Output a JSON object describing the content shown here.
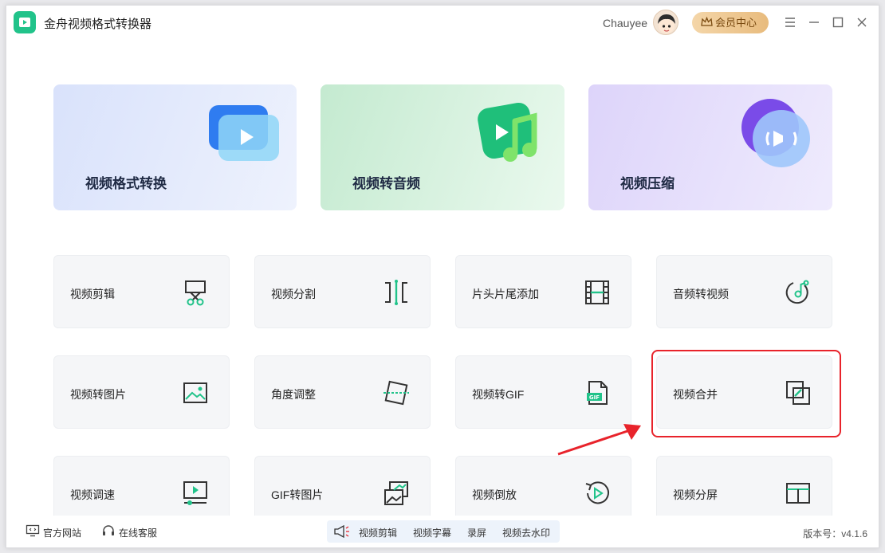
{
  "app": {
    "title": "金舟视频格式转换器"
  },
  "header": {
    "user_name": "Chauyee",
    "vip_label": "会员中心"
  },
  "feature_cards": [
    {
      "label": "视频格式转换",
      "icon": "video-convert-icon",
      "bg_from": "#dde5fb",
      "bg_to": "#eef2fd"
    },
    {
      "label": "视频转音频",
      "icon": "video-to-audio-icon",
      "bg_from": "#c9ecd4",
      "bg_to": "#e8f8ec"
    },
    {
      "label": "视频压缩",
      "icon": "video-compress-icon",
      "bg_from": "#e3dcfb",
      "bg_to": "#efeafd"
    }
  ],
  "tools": [
    {
      "label": "视频剪辑",
      "icon": "scissors-icon"
    },
    {
      "label": "视频分割",
      "icon": "split-icon"
    },
    {
      "label": "片头片尾添加",
      "icon": "film-strip-icon"
    },
    {
      "label": "音频转视频",
      "icon": "music-disc-icon"
    },
    {
      "label": "视频转图片",
      "icon": "image-icon"
    },
    {
      "label": "角度调整",
      "icon": "rotate-frame-icon"
    },
    {
      "label": "视频转GIF",
      "icon": "gif-file-icon"
    },
    {
      "label": "视频合并",
      "icon": "merge-icon"
    },
    {
      "label": "视频调速",
      "icon": "speed-icon"
    },
    {
      "label": "GIF转图片",
      "icon": "gif-to-image-icon"
    },
    {
      "label": "视频倒放",
      "icon": "reverse-play-icon"
    },
    {
      "label": "视频分屏",
      "icon": "split-screen-icon"
    }
  ],
  "footer": {
    "website": "官方网站",
    "support": "在线客服",
    "quick_links": [
      "视频剪辑",
      "视频字幕",
      "录屏",
      "视频去水印"
    ],
    "version": "版本号：v4.1.6"
  },
  "colors": {
    "accent": "#21c38a",
    "highlight": "#e8232b"
  }
}
